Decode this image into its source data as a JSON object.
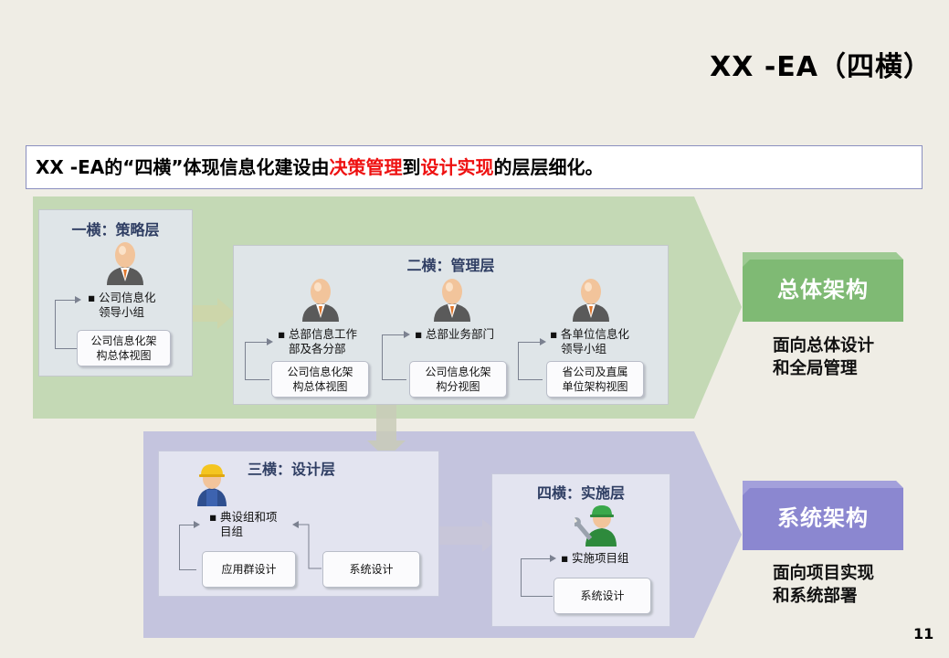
{
  "title": "XX -EA（四横）",
  "subtitle": {
    "prefix": "XX -EA的“四横”体现信息化建设由",
    "highlight1": "决策管理",
    "middle": "到",
    "highlight2": "设计实现",
    "suffix": "的层层细化。"
  },
  "layer1": {
    "title": "一横：策略层",
    "bullet": [
      "公司信息化",
      "领导小组"
    ],
    "box": [
      "公司信息化架",
      "构总体视图"
    ]
  },
  "layer2": {
    "title": "二横：管理层",
    "columns": [
      {
        "bullet": [
          "总部信息工作",
          "部及各分部"
        ],
        "box": [
          "公司信息化架",
          "构总体视图"
        ]
      },
      {
        "bullet": [
          "总部业务部门"
        ],
        "box": [
          "公司信息化架",
          "构分视图"
        ]
      },
      {
        "bullet": [
          "各单位信息化",
          "领导小组"
        ],
        "box": [
          "省公司及直属",
          "单位架构视图"
        ]
      }
    ]
  },
  "layer3": {
    "title": "三横：设计层",
    "bullet": [
      "典设组和项",
      "目组"
    ],
    "box_left": "应用群设计",
    "box_right": "系统设计"
  },
  "layer4": {
    "title": "四横：实施层",
    "bullet": "实施项目组",
    "box": "系统设计"
  },
  "side": {
    "top_label": "总体架构",
    "top_text": [
      "面向总体设计",
      "和全局管理"
    ],
    "bottom_label": "系统架构",
    "bottom_text": [
      "面向项目实现",
      "和系统部署"
    ],
    "top_color": "#7fba74",
    "bottom_color": "#8b87d0"
  },
  "page_number": "11",
  "colors": {
    "band_green": "#c4d9b5",
    "band_purple": "#c4c4de",
    "highlight_red": "#ee1111"
  }
}
